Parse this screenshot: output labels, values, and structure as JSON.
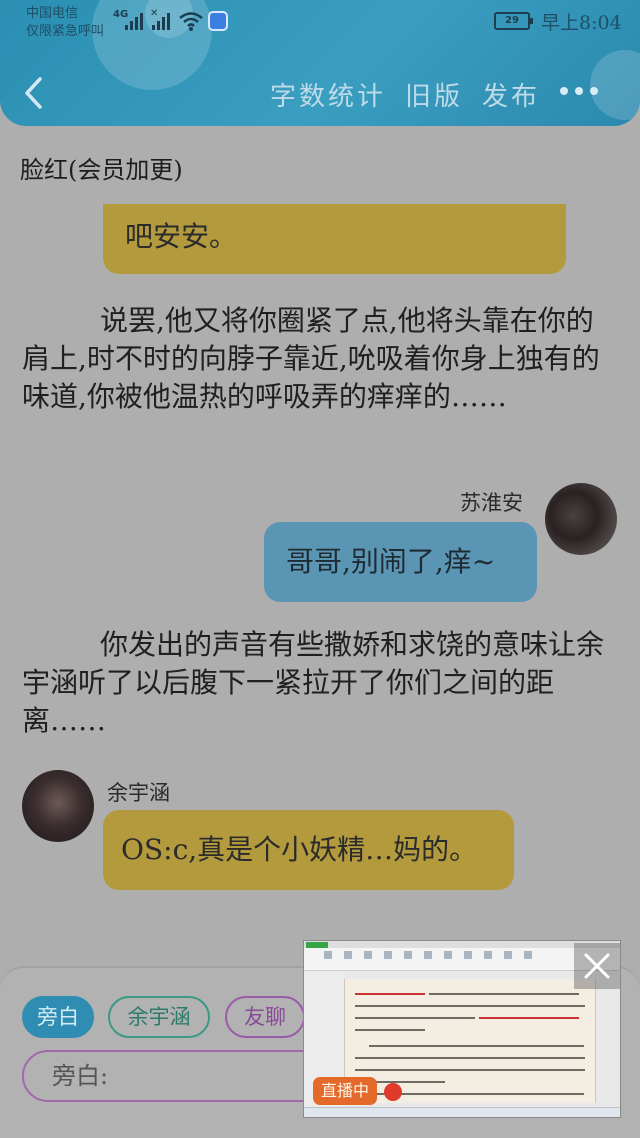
{
  "status_bar": {
    "carrier_line1": "中国电信",
    "carrier_line2": "仅限紧急呼叫",
    "network": "4G",
    "battery": "29",
    "time": "早上8:04"
  },
  "nav": {
    "actions": [
      "字数统计",
      "旧版",
      "发布"
    ]
  },
  "chapter_title": "脸红(会员加更)",
  "messages": {
    "top_bubble_partial": "吧安安。",
    "narration_1": "说罢,他又将你圈紧了点,他将头靠在你的肩上,时不时的向脖子靠近,吮吸着你身上独有的味道,你被他温热的呼吸弄的痒痒的……",
    "speaker_1_name": "苏淮安",
    "speaker_1_text": "哥哥,别闹了,痒~",
    "narration_2": "你发出的声音有些撒娇和求饶的意味让余宇涵听了以后腹下一紧拉开了你们之间的距离……",
    "speaker_2_name": "余宇涵",
    "speaker_2_text": "OS:c,真是个小妖精…妈的。"
  },
  "roles": {
    "chips": [
      "旁白",
      "余宇涵",
      "友聊"
    ]
  },
  "input": {
    "placeholder": "旁白:"
  },
  "floating_window": {
    "live_label": "直播中"
  },
  "colors": {
    "header": "#2a8fb2",
    "yellow_bubble": "#b39a3c",
    "blue_bubble": "#5a96b4",
    "overlay_gray": "#aeaeae"
  }
}
